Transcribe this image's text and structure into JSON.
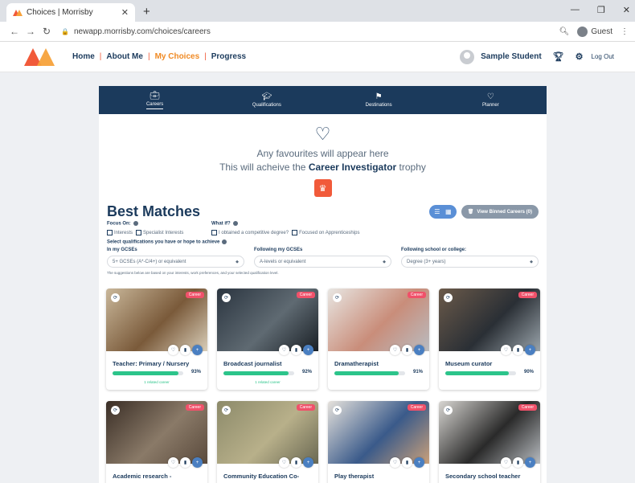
{
  "browser": {
    "tab_title": "Choices | Morrisby",
    "url": "newapp.morrisby.com/choices/careers",
    "guest_label": "Guest"
  },
  "header": {
    "nav": [
      "Home",
      "About Me",
      "My Choices",
      "Progress"
    ],
    "active_nav": "My Choices",
    "user_name": "Sample Student",
    "logout": "Log Out"
  },
  "tabs": [
    {
      "label": "Careers",
      "icon": "briefcase-icon"
    },
    {
      "label": "Qualifications",
      "icon": "graduation-cap-icon"
    },
    {
      "label": "Destinations",
      "icon": "signpost-icon"
    },
    {
      "label": "Planner",
      "icon": "heart-icon"
    }
  ],
  "favourites": {
    "line1": "Any favourites will appear here",
    "line2_prefix": "This will acheive the",
    "line2_bold": "Career Investigator",
    "line2_suffix": "trophy"
  },
  "best_matches": {
    "title": "Best Matches",
    "binned_button": "View Binned Careers (0)",
    "focus_on_label": "Focus On:",
    "focus_options": [
      "Interests",
      "Specialist Interests"
    ],
    "what_if_label": "What if?",
    "what_if_options": [
      "I obtained a competitive degree?",
      "Focused on Apprenticeships"
    ],
    "qual_prompt": "Select qualifications you have or hope to achieve",
    "selects": [
      {
        "label": "In my GCSEs",
        "value": "5+ GCSEs (A*-C/4+) or equivalent"
      },
      {
        "label": "Following my GCSEs",
        "value": "A-levels or equivalent"
      },
      {
        "label": "Following school or college:",
        "value": "Degree (3+ years)"
      }
    ],
    "note": "The suggestions below are based on your interests, work preferences, and your selected qualification level."
  },
  "cards": [
    {
      "title": "Teacher: Primary / Nursery",
      "match": "93%",
      "match_value": 0.93,
      "related": "1 related career",
      "badge": "Career",
      "colors": [
        "#c9b79a",
        "#7a5a3a",
        "#d8cdb8"
      ]
    },
    {
      "title": "Broadcast journalist",
      "match": "92%",
      "match_value": 0.92,
      "related": "1 related career",
      "badge": "Career",
      "colors": [
        "#2b3540",
        "#5f6a72",
        "#1a2026"
      ]
    },
    {
      "title": "Dramatherapist",
      "match": "91%",
      "match_value": 0.91,
      "related": "",
      "badge": "Career",
      "colors": [
        "#e8e6e2",
        "#c98d7a",
        "#b9bcc0"
      ]
    },
    {
      "title": "Museum curator",
      "match": "90%",
      "match_value": 0.9,
      "related": "",
      "badge": "Career",
      "colors": [
        "#6b5a4a",
        "#2a2f35",
        "#9aa4ab"
      ]
    },
    {
      "title": "Academic research -",
      "match": "",
      "match_value": 0,
      "related": "",
      "badge": "Career",
      "colors": [
        "#3a2e26",
        "#8a7a68",
        "#5a4a3c"
      ]
    },
    {
      "title": "Community Education Co-",
      "match": "",
      "match_value": 0,
      "related": "",
      "badge": "Career",
      "colors": [
        "#8c8a6a",
        "#b8b08a",
        "#6a6852"
      ]
    },
    {
      "title": "Play therapist",
      "match": "",
      "match_value": 0,
      "related": "",
      "badge": "Career",
      "colors": [
        "#e6e2dc",
        "#3a5a8a",
        "#c9a07a"
      ]
    },
    {
      "title": "Secondary school teacher",
      "match": "",
      "match_value": 0,
      "related": "",
      "badge": "Career",
      "colors": [
        "#d8d6d2",
        "#2a2a2a",
        "#b8bcc0"
      ]
    }
  ]
}
